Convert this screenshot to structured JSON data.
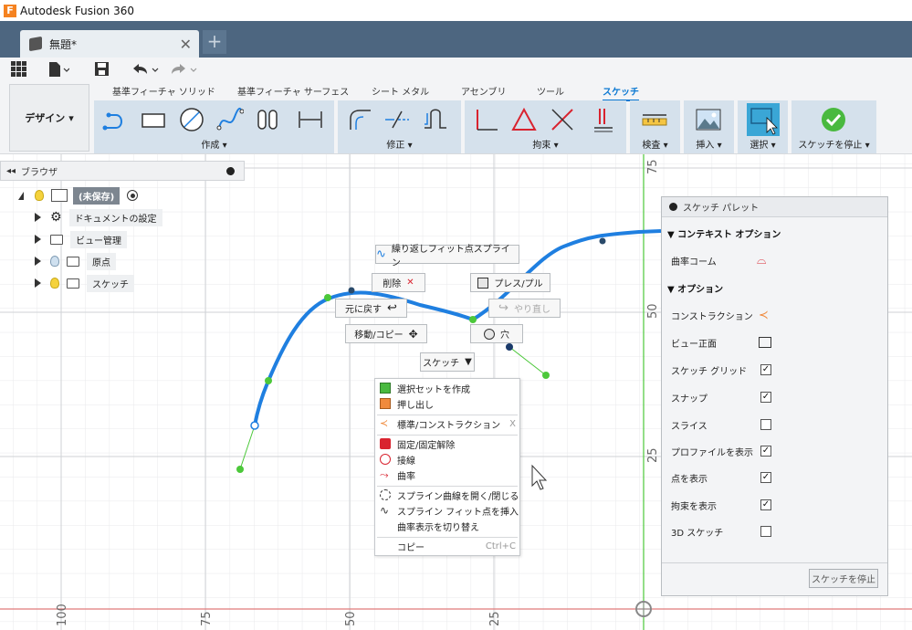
{
  "app": {
    "title": "Autodesk Fusion 360",
    "logo_letter": "F"
  },
  "document_tab": {
    "title": "無題*",
    "close": "✕",
    "new_tab": "+"
  },
  "ribbon": {
    "workspace": "デザイン",
    "tabs": [
      "基準フィーチャ ソリッド",
      "基準フィーチャ サーフェス",
      "シート メタル",
      "アセンブリ",
      "ツール",
      "スケッチ"
    ],
    "active_tab": "スケッチ",
    "groups": {
      "create": "作成 ▾",
      "modify": "修正 ▾",
      "constraints": "拘束 ▾",
      "inspect": "検査 ▾",
      "insert": "挿入 ▾",
      "select": "選択 ▾",
      "finish": "スケッチを停止 ▾"
    }
  },
  "browser": {
    "title": "ブラウザ",
    "root": "(未保存)",
    "items": [
      "ドキュメントの設定",
      "ビュー管理",
      "原点",
      "スケッチ"
    ]
  },
  "floating": {
    "spline_fit": "繰り返しフィット点スプライン",
    "delete": "削除",
    "press_pull": "プレス/プル",
    "undo": "元に戻す",
    "redo": "やり直し",
    "move_copy": "移動/コピー",
    "hole": "穴",
    "sketch_dropdown": "スケッチ"
  },
  "context_menu": {
    "items": [
      {
        "label": "選択セットを作成",
        "icon": "selection-set-icon"
      },
      {
        "label": "押し出し",
        "icon": "extrude-icon"
      },
      {
        "label": "標準/コンストラクション",
        "icon": "construction-icon",
        "shortcut": "X"
      },
      {
        "label": "固定/固定解除",
        "icon": "lock-icon"
      },
      {
        "label": "接線",
        "icon": "tangent-icon"
      },
      {
        "label": "曲率",
        "icon": "curvature-icon"
      },
      {
        "label": "スプライン曲線を開く/閉じる",
        "icon": "spline-open-close-icon"
      },
      {
        "label": "スプライン フィット点を挿入",
        "icon": "spline-insert-point-icon"
      },
      {
        "label": "曲率表示を切り替え",
        "icon": ""
      },
      {
        "label": "コピー",
        "icon": "",
        "shortcut": "Ctrl+C"
      }
    ]
  },
  "palette": {
    "title": "スケッチ パレット",
    "context_section": "コンテキスト オプション",
    "curvature_comb": "曲率コーム",
    "options_section": "オプション",
    "construction": "コンストラクション",
    "look_at": "ビュー正面",
    "options": [
      {
        "label": "スケッチ グリッド",
        "checked": true
      },
      {
        "label": "スナップ",
        "checked": true
      },
      {
        "label": "スライス",
        "checked": false
      },
      {
        "label": "プロファイルを表示",
        "checked": true
      },
      {
        "label": "点を表示",
        "checked": true
      },
      {
        "label": "拘束を表示",
        "checked": true
      },
      {
        "label": "3D スケッチ",
        "checked": false
      }
    ],
    "stop_button": "スケッチを停止"
  },
  "axis_labels": {
    "bottom": [
      "100",
      "75",
      "50",
      "25"
    ],
    "right": [
      "75",
      "50",
      "25"
    ]
  },
  "colors": {
    "accent": "#0a78d2",
    "spline": "#1f7fe0",
    "tabbar": "#4d6680",
    "ribbon_group": "#d5e1ec",
    "green_point": "#4cc83a",
    "axis_red": "#e07a7a",
    "axis_green": "#4cc83a"
  }
}
